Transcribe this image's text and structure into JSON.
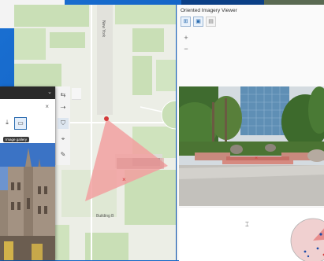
{
  "map": {
    "street_label": "New York",
    "building_label": "Building B"
  },
  "viewer": {
    "title": "Oriented Imagery Viewer",
    "zoom_in": "+",
    "zoom_out": "−",
    "tools": [
      {
        "icon": "image-selection-icon"
      },
      {
        "icon": "image-gallery-icon"
      },
      {
        "icon": "grid-icon"
      }
    ]
  },
  "dialog": {
    "tooltip": "Image gallery",
    "close": "×",
    "collapse": "⌄"
  },
  "colors": {
    "desktop": "#1467c8",
    "map_base": "#eceee6",
    "map_green": "#c9dfb6",
    "camera_cone": "#f2a0a0",
    "camera_marker": "#d43a3a",
    "dialog_header": "#2a2a2a"
  }
}
